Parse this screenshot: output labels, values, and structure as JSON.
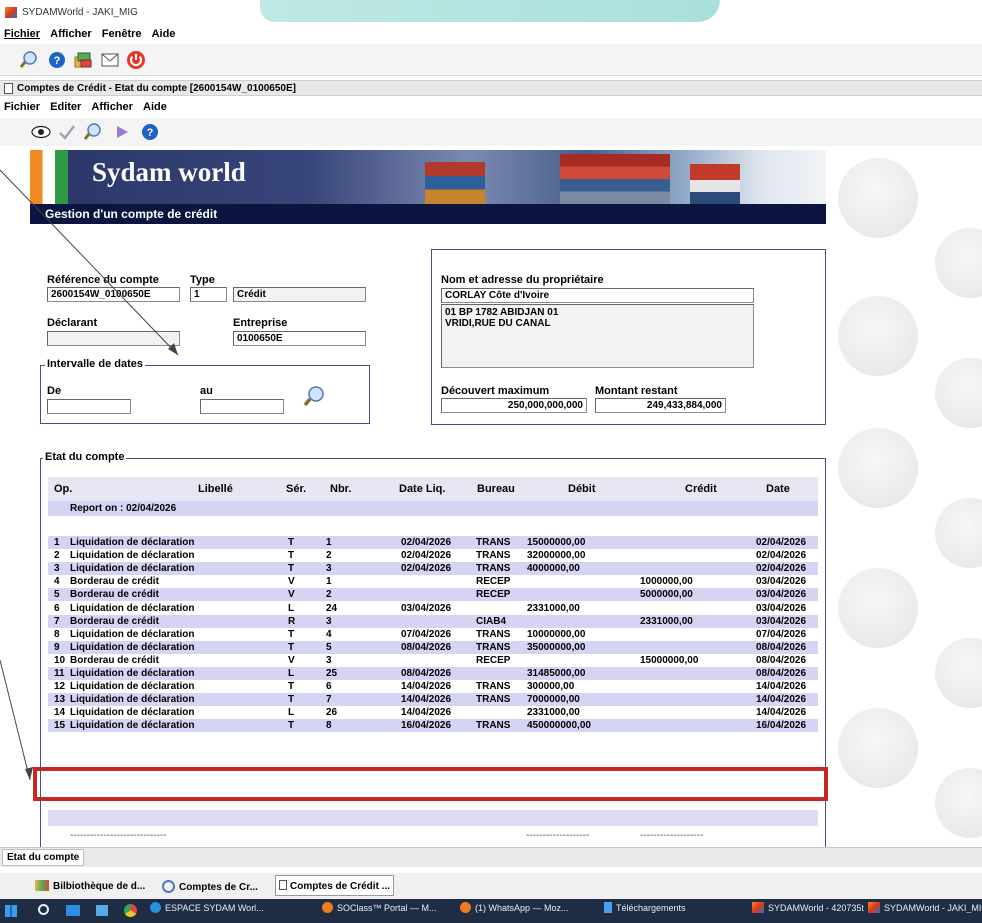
{
  "app": {
    "title": "SYDAMWorld - JAKI_MIG"
  },
  "main_menu": [
    "Fichier",
    "Afficher",
    "Fenêtre",
    "Aide"
  ],
  "main_toolbar": [
    "search-icon",
    "help-icon",
    "library-icon",
    "mail-icon",
    "power-icon"
  ],
  "child_window": {
    "title": "Comptes de Crédit - Etat du compte [2600154W_0100650E]"
  },
  "child_menu": [
    "Fichier",
    "Editer",
    "Afficher",
    "Aide"
  ],
  "child_toolbar": [
    "eye-icon",
    "check-icon",
    "search-icon",
    "play-icon",
    "help-icon"
  ],
  "banner": {
    "brand": "Sydam world",
    "subtitle": "Gestion d'un compte de crédit"
  },
  "form": {
    "ref_label": "Référence du compte",
    "ref_value": "2600154W_0100650E",
    "type_label": "Type",
    "type_code": "1",
    "type_text": "Crédit",
    "declarant_label": "Déclarant",
    "declarant_value": "",
    "entreprise_label": "Entreprise",
    "entreprise_value": "0100650E",
    "interval_legend": "Intervalle de dates",
    "de_label": "De",
    "de_value": "",
    "au_label": "au",
    "au_value": "",
    "owner_label": "Nom et adresse du propriétaire",
    "owner_name": "CORLAY Côte d'Ivoire",
    "owner_addr1": "01 BP 1782 ABIDJAN 01",
    "owner_addr2": "VRIDI,RUE DU CANAL",
    "decouvert_label": "Découvert maximum",
    "decouvert_value": "250,000,000,000",
    "restant_label": "Montant restant",
    "restant_value": "249,433,884,000"
  },
  "etat": {
    "legend": "Etat du compte",
    "headers": {
      "op": "Op.",
      "libelle": "Libellé",
      "ser": "Sér.",
      "nbr": "Nbr.",
      "dateliq": "Date Liq.",
      "bureau": "Bureau",
      "debit": "Débit",
      "credit": "Crédit",
      "date": "Date"
    },
    "report": "Report on : 02/04/2026",
    "rows": [
      {
        "op": "1",
        "lib": "Liquidation de déclaration",
        "ser": "T",
        "nbr": "1",
        "dl": "02/04/2026",
        "bur": "TRANS",
        "deb": "15000000,00",
        "cre": "",
        "date": "02/04/2026"
      },
      {
        "op": "2",
        "lib": "Liquidation de déclaration",
        "ser": "T",
        "nbr": "2",
        "dl": "02/04/2026",
        "bur": "TRANS",
        "deb": "32000000,00",
        "cre": "",
        "date": "02/04/2026"
      },
      {
        "op": "3",
        "lib": "Liquidation de déclaration",
        "ser": "T",
        "nbr": "3",
        "dl": "02/04/2026",
        "bur": "TRANS",
        "deb": "4000000,00",
        "cre": "",
        "date": "02/04/2026"
      },
      {
        "op": "4",
        "lib": "Borderau de crédit",
        "ser": "V",
        "nbr": "1",
        "dl": "",
        "bur": "RECEP",
        "deb": "",
        "cre": "1000000,00",
        "date": "03/04/2026"
      },
      {
        "op": "5",
        "lib": "Borderau de crédit",
        "ser": "V",
        "nbr": "2",
        "dl": "",
        "bur": "RECEP",
        "deb": "",
        "cre": "5000000,00",
        "date": "03/04/2026"
      },
      {
        "op": "6",
        "lib": "Liquidation de déclaration",
        "ser": "L",
        "nbr": "24",
        "dl": "03/04/2026",
        "bur": "",
        "deb": "2331000,00",
        "cre": "",
        "date": "03/04/2026"
      },
      {
        "op": "7",
        "lib": "Borderau de crédit",
        "ser": "R",
        "nbr": "3",
        "dl": "",
        "bur": "CIAB4",
        "deb": "",
        "cre": "2331000,00",
        "date": "03/04/2026"
      },
      {
        "op": "8",
        "lib": "Liquidation de déclaration",
        "ser": "T",
        "nbr": "4",
        "dl": "07/04/2026",
        "bur": "TRANS",
        "deb": "10000000,00",
        "cre": "",
        "date": "07/04/2026"
      },
      {
        "op": "9",
        "lib": "Liquidation de déclaration",
        "ser": "T",
        "nbr": "5",
        "dl": "08/04/2026",
        "bur": "TRANS",
        "deb": "35000000,00",
        "cre": "",
        "date": "08/04/2026"
      },
      {
        "op": "10",
        "lib": "Borderau de crédit",
        "ser": "V",
        "nbr": "3",
        "dl": "",
        "bur": "RECEP",
        "deb": "",
        "cre": "15000000,00",
        "date": "08/04/2026"
      },
      {
        "op": "11",
        "lib": "Liquidation de déclaration",
        "ser": "L",
        "nbr": "25",
        "dl": "08/04/2026",
        "bur": "",
        "deb": "31485000,00",
        "cre": "",
        "date": "08/04/2026"
      },
      {
        "op": "12",
        "lib": "Liquidation de déclaration",
        "ser": "T",
        "nbr": "6",
        "dl": "14/04/2026",
        "bur": "TRANS",
        "deb": "300000,00",
        "cre": "",
        "date": "14/04/2026"
      },
      {
        "op": "13",
        "lib": "Liquidation de déclaration",
        "ser": "T",
        "nbr": "7",
        "dl": "14/04/2026",
        "bur": "TRANS",
        "deb": "7000000,00",
        "cre": "",
        "date": "14/04/2026"
      },
      {
        "op": "14",
        "lib": "Liquidation de déclaration",
        "ser": "L",
        "nbr": "26",
        "dl": "14/04/2026",
        "bur": "",
        "deb": "2331000,00",
        "cre": "",
        "date": "14/04/2026"
      },
      {
        "op": "15",
        "lib": "Liquidation de déclaration",
        "ser": "T",
        "nbr": "8",
        "dl": "16/04/2026",
        "bur": "TRANS",
        "deb": "450000000,00",
        "cre": "",
        "date": "16/04/2026"
      }
    ],
    "total_placeholder": "-----------------------------"
  },
  "status_tab": "Etat du compte",
  "mdi_tabs": [
    "Bilbiothèque de d...",
    "Comptes de Cr...",
    "Comptes de Crédit ..."
  ],
  "taskbar": [
    "ESPACE SYDAM Worl...",
    "SOClass™ Portal — M...",
    "(1) WhatsApp — Moz...",
    "Téléchargements",
    "SYDAMWorld - 420735t",
    "SYDAMWorld - JAKI_MIG"
  ],
  "colors": {
    "accent_red": "#c62828",
    "row_purple": "#d6d4f4",
    "banner_navy": "#0b1540",
    "title_bar": "#e8e8e8"
  }
}
